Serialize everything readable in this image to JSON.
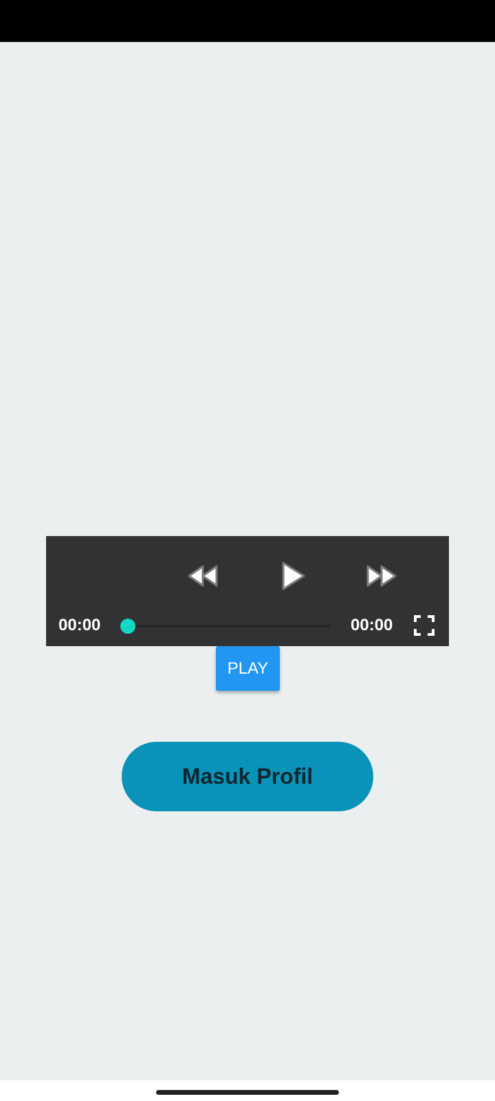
{
  "player": {
    "current_time": "00:00",
    "total_time": "00:00",
    "progress": 0,
    "icons": {
      "rewind": "rewind-icon",
      "play": "play-icon",
      "forward": "fast-forward-icon",
      "fullscreen": "fullscreen-icon"
    }
  },
  "play_button": {
    "label": "PLAY"
  },
  "profile_button": {
    "label": "Masuk Profil"
  },
  "colors": {
    "status_bar": "#000000",
    "background": "#ebeff0",
    "player_bg": "#313233",
    "seek_thumb": "#14d8c6",
    "play_button": "#2196f3",
    "profile_button": "#0993b8",
    "profile_text": "#0d2630"
  }
}
